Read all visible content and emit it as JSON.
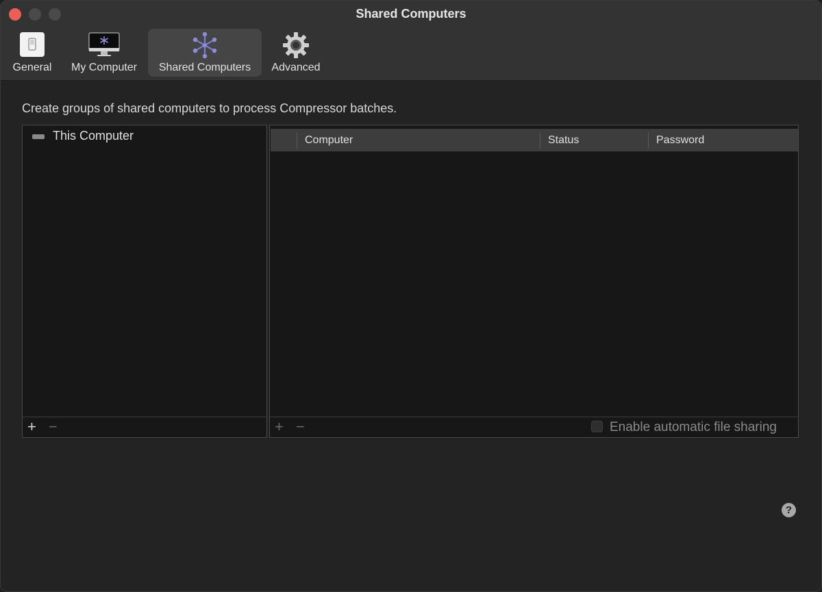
{
  "window": {
    "title": "Shared Computers"
  },
  "toolbar": {
    "items": [
      {
        "label": "General",
        "icon": "switch-icon",
        "selected": false
      },
      {
        "label": "My Computer",
        "icon": "monitor-icon",
        "selected": false
      },
      {
        "label": "Shared Computers",
        "icon": "network-icon",
        "selected": true
      },
      {
        "label": "Advanced",
        "icon": "gear-icon",
        "selected": false
      }
    ]
  },
  "main": {
    "instructions": "Create groups of shared computers to process Compressor batches.",
    "groups": {
      "items": [
        {
          "label": "This Computer",
          "icon": "drive-icon"
        }
      ],
      "add_label": "+",
      "remove_label": "−"
    },
    "computers": {
      "columns": [
        "Computer",
        "Status",
        "Password"
      ],
      "rows": [],
      "add_label": "+",
      "remove_label": "−",
      "file_sharing_label": "Enable automatic file sharing",
      "file_sharing_checked": false
    },
    "help_label": "?"
  },
  "colors": {
    "close_button": "#ec5f59",
    "window_bg": "#232323",
    "toolbar_bg": "#333333",
    "selected_tab_bg": "#454545",
    "panel_bg": "#171717",
    "network_icon": "#7b79c4"
  }
}
